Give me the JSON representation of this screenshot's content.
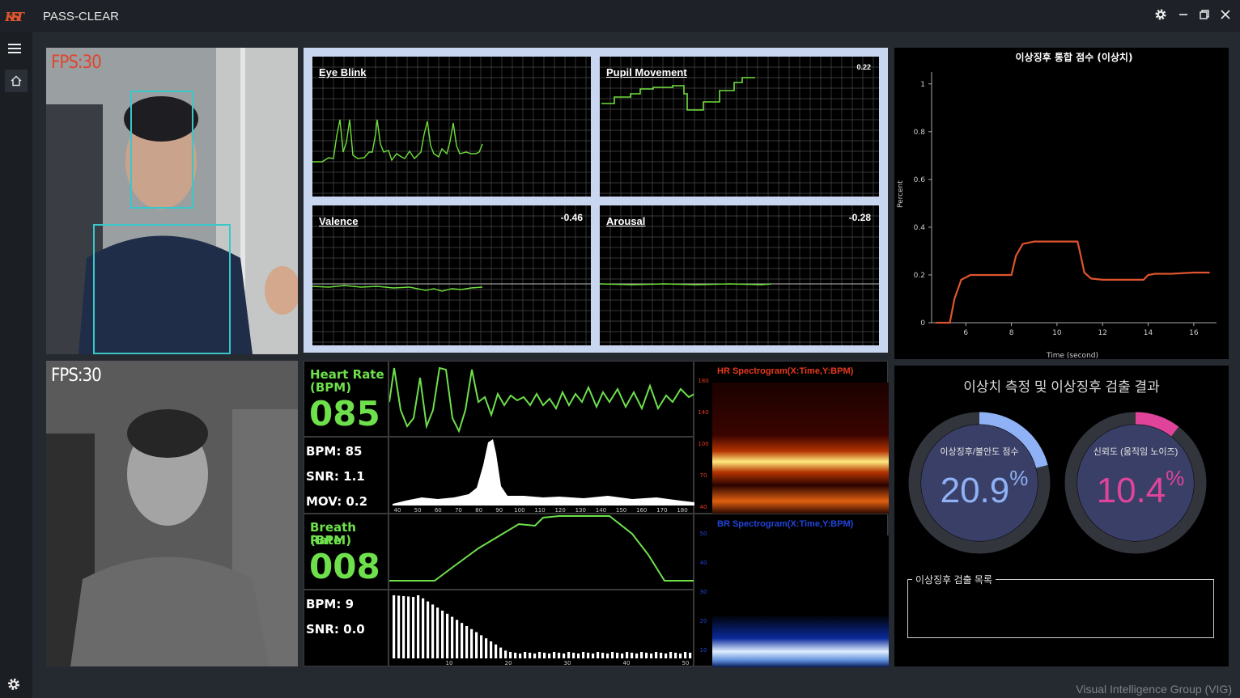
{
  "window": {
    "logo_text": "KIST",
    "title": "PASS-CLEAR",
    "icons": [
      "gear-icon",
      "minimize-icon",
      "restore-icon",
      "close-icon"
    ]
  },
  "sidebar": {
    "icons": [
      "menu-icon",
      "home-icon",
      "settings-icon"
    ]
  },
  "camera_rgb": {
    "fps": "FPS:30"
  },
  "camera_ir": {
    "fps": "FPS:30"
  },
  "graphs": {
    "eye_blink": {
      "title": "Eye Blink",
      "value": ""
    },
    "pupil_movement": {
      "title": "Pupil Movement",
      "value": "0.22"
    },
    "valence": {
      "title": "Valence",
      "value": "-0.46"
    },
    "arousal": {
      "title": "Arousal",
      "value": "-0.28"
    }
  },
  "chart_data": {
    "type": "line",
    "title": "이상징후 통합 점수 (이상치)",
    "xlabel": "Time (second)",
    "ylabel": "Percent",
    "xlim": [
      4.5,
      17
    ],
    "ylim": [
      0,
      1.05
    ],
    "xticks": [
      6,
      8,
      10,
      12,
      14,
      16
    ],
    "yticks": [
      0,
      0.2,
      0.4,
      0.6,
      0.8,
      1
    ],
    "x": [
      4.7,
      5.3,
      5.5,
      5.8,
      6.2,
      7.0,
      8.0,
      8.2,
      8.5,
      9.0,
      10.0,
      10.9,
      11.0,
      11.2,
      11.5,
      12.0,
      13.0,
      13.8,
      14.0,
      14.3,
      15.0,
      16.0,
      16.7
    ],
    "y": [
      0,
      0,
      0.1,
      0.18,
      0.2,
      0.2,
      0.2,
      0.28,
      0.33,
      0.34,
      0.34,
      0.34,
      0.3,
      0.21,
      0.185,
      0.18,
      0.18,
      0.18,
      0.2,
      0.205,
      0.205,
      0.21,
      0.21
    ],
    "color": "#e0552e",
    "grid": false
  },
  "heart": {
    "label_line1": "Heart Rate",
    "label_line2": "(BPM)",
    "value": "085",
    "bpm": "BPM: 85",
    "snr": "SNR: 1.1",
    "mov": "MOV: 0.2",
    "fft_ticks": [
      "40",
      "50",
      "60",
      "70",
      "80",
      "90",
      "100",
      "110",
      "120",
      "130",
      "140",
      "150",
      "160",
      "170",
      "180"
    ],
    "spectrogram_title": "HR Spectrogram(X:Time,Y:BPM)",
    "spectrogram_yticks": [
      "180",
      "140",
      "100",
      "70",
      "40"
    ]
  },
  "breath": {
    "label_line1": "Breath Rate",
    "label_line2": "(BPM)",
    "value": "008",
    "bpm": "BPM: 9",
    "snr": "SNR: 0.0",
    "fft_ticks": [
      "10",
      "20",
      "30",
      "40",
      "50"
    ],
    "spectrogram_title": "BR Spectrogram(X:Time,Y:BPM)",
    "spectrogram_yticks": [
      "50",
      "40",
      "30",
      "20",
      "10"
    ]
  },
  "result": {
    "title": "이상치 측정 및 이상징후 검출 결과",
    "anomaly": {
      "label": "이상징후/불안도 점수",
      "value": "20.9",
      "unit": "%",
      "fraction": 0.209,
      "color": "#8fb1f5"
    },
    "reliability": {
      "label": "신뢰도 (움직임 노이즈)",
      "value": "10.4",
      "unit": "%",
      "fraction": 0.104,
      "color": "#e0449a"
    },
    "list_label": "이상징후 검출 목록"
  },
  "footer": {
    "credit": "Visual Intelligence Group (VIG)"
  }
}
